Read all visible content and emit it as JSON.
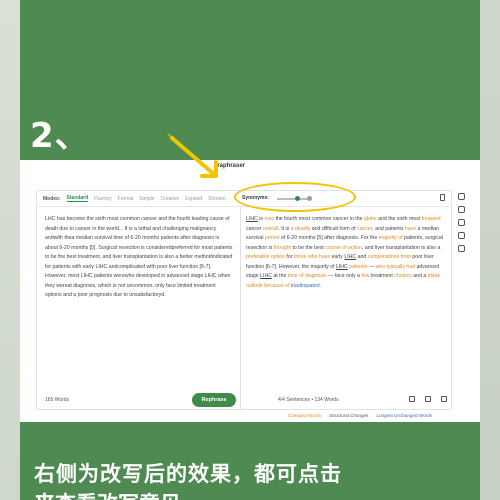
{
  "step_number": "2、",
  "window_title": "araphraser",
  "modes": {
    "label": "Modes:",
    "items": [
      "Standard",
      "Fluency",
      "Formal",
      "Simple",
      "Creative",
      "Expand",
      "Shorten"
    ],
    "active": "Standard",
    "synonyms_label": "Synonyms:"
  },
  "input_text": "LHC has become the sixth most common cancer and the fourth leading cause of death due to cancer in the world... It is a lethal and challenging malignancy andwith thea median survival time of 6-20 months patients after diagnosis is about 6-20 months [5]. Surgical resection is consideredpreferred for most patients to be the best treatment, and liver transplantation is also a better methodindicated for patients with early LIHC andcomplicated with poor liver function [6-7]. However, most LIHC patients werewho developed in advanced stage LIHC when they wereat diagnosis, which is not uncommon, only face limited treatment options and a poor prognosis due to unsatisfactoryd.",
  "output_parts": [
    {
      "t": "LIHC",
      "k": "u"
    },
    {
      "t": " is ",
      "k": ""
    },
    {
      "t": "now",
      "k": "c"
    },
    {
      "t": " the fourth most common cancer in the ",
      "k": ""
    },
    {
      "t": "globe",
      "k": "c"
    },
    {
      "t": " and the sixth most ",
      "k": ""
    },
    {
      "t": "frequent",
      "k": "c"
    },
    {
      "t": " cancer ",
      "k": ""
    },
    {
      "t": "overall",
      "k": "c"
    },
    {
      "t": ". It is ",
      "k": ""
    },
    {
      "t": "a deadly",
      "k": "c"
    },
    {
      "t": " and difficult form of ",
      "k": ""
    },
    {
      "t": "cancer",
      "k": "c"
    },
    {
      "t": ", and patients ",
      "k": ""
    },
    {
      "t": "have",
      "k": "c"
    },
    {
      "t": " a median survival ",
      "k": ""
    },
    {
      "t": "period",
      "k": "c"
    },
    {
      "t": " of 6-20 months [5] after diagnosis. For the ",
      "k": ""
    },
    {
      "t": "majority of",
      "k": "c"
    },
    {
      "t": " patients, surgical resection is ",
      "k": ""
    },
    {
      "t": "thought",
      "k": "c"
    },
    {
      "t": " to be the best ",
      "k": ""
    },
    {
      "t": "course of action",
      "k": "c"
    },
    {
      "t": ", and liver transplantation is also a ",
      "k": ""
    },
    {
      "t": "preferable option",
      "k": "c"
    },
    {
      "t": " for ",
      "k": ""
    },
    {
      "t": "those who have",
      "k": "c"
    },
    {
      "t": " early ",
      "k": ""
    },
    {
      "t": "LIHC",
      "k": "u"
    },
    {
      "t": " and ",
      "k": ""
    },
    {
      "t": "complications from",
      "k": "c"
    },
    {
      "t": " poor liver function [6-7]. However, the majority of ",
      "k": ""
    },
    {
      "t": "LIHC",
      "k": "u"
    },
    {
      "t": " ",
      "k": ""
    },
    {
      "t": "patients",
      "k": "c"
    },
    {
      "t": " — ",
      "k": ""
    },
    {
      "t": "who typically had",
      "k": "c"
    },
    {
      "t": " advanced stage ",
      "k": ""
    },
    {
      "t": "LIHC",
      "k": "u"
    },
    {
      "t": " at the ",
      "k": ""
    },
    {
      "t": "time of diagnosis",
      "k": "c"
    },
    {
      "t": " — face only a ",
      "k": ""
    },
    {
      "t": "few",
      "k": "c"
    },
    {
      "t": " treatment ",
      "k": ""
    },
    {
      "t": "choices",
      "k": "c"
    },
    {
      "t": " and a ",
      "k": ""
    },
    {
      "t": "bleak outlook because of",
      "k": "c"
    },
    {
      "t": " ",
      "k": ""
    },
    {
      "t": "inadequated",
      "k": "s"
    },
    {
      "t": ".",
      "k": ""
    }
  ],
  "left_footer": {
    "words": "165 Words",
    "button": "Rephrase"
  },
  "right_footer": {
    "stats": "4/4 Sentences  •  134 Words"
  },
  "legend": {
    "changed": "Changed Words",
    "structural": "Structural Changes",
    "longest": "Longest Unchanged Words"
  },
  "caption_line1": "右侧为改写后的效果，都可点击",
  "caption_line2": "来查看改写意见",
  "colors": {
    "green": "#4e8a51",
    "accent": "#f2c300",
    "changed": "#e08a1e",
    "structural": "#3a66c9"
  }
}
